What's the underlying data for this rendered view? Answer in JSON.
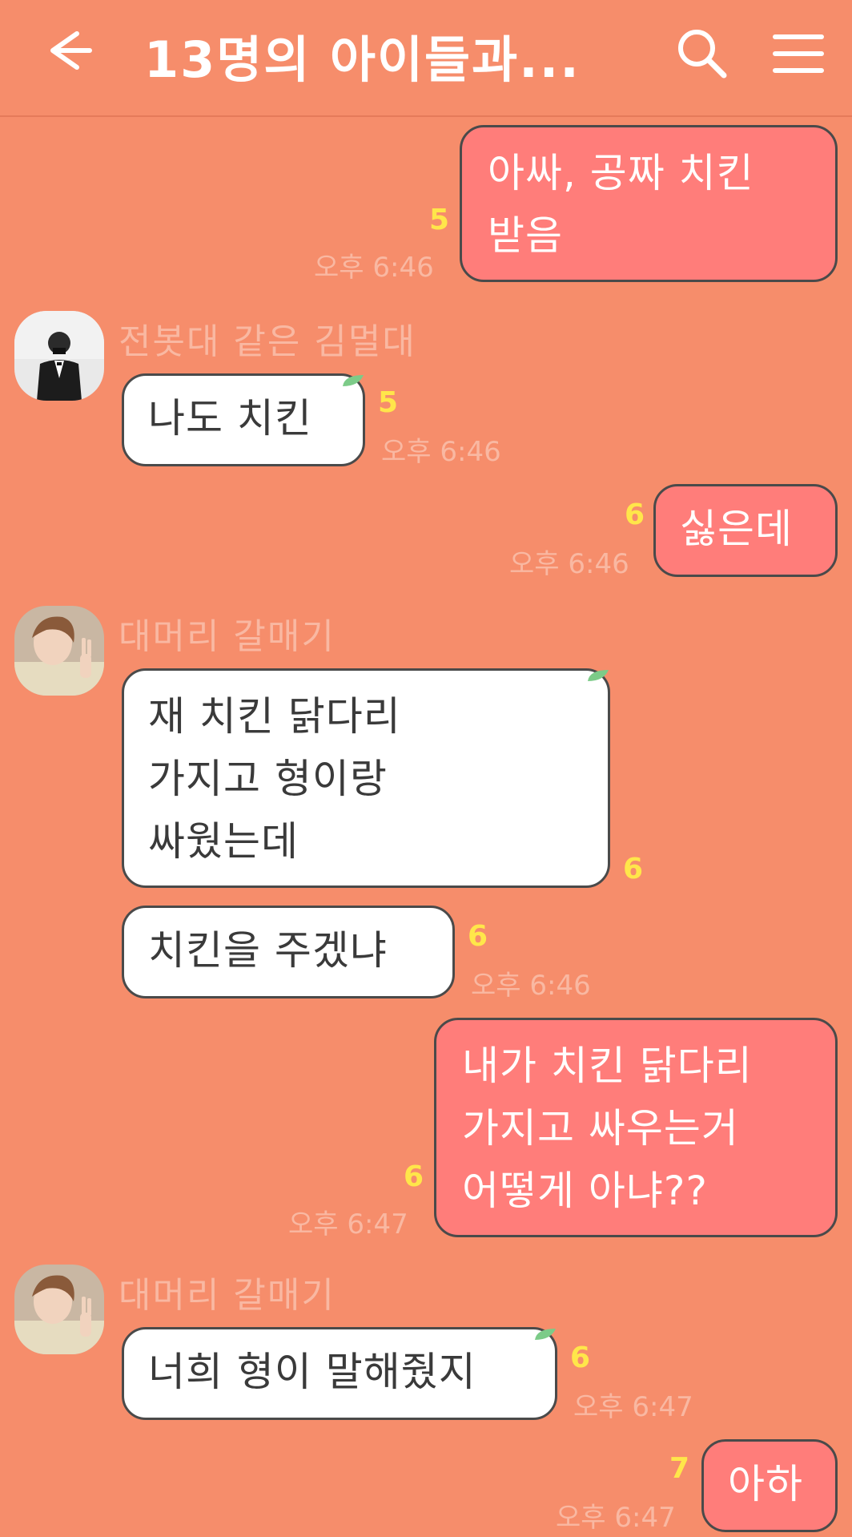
{
  "header": {
    "title": "13명의 아이들과...",
    "back_icon": "arrow-left-icon",
    "search_icon": "search-icon",
    "menu_icon": "hamburger-menu-icon",
    "text_color": "#FFFFFF"
  },
  "colors": {
    "background": "#F68D6B",
    "my_bubble": "#FF7D7A",
    "their_bubble": "#FFFFFF",
    "unread": "#FFE64A",
    "meta": "#F9B8A2"
  },
  "messages": [
    {
      "from": "me",
      "text": "아싸, 공짜 치킨\n받음",
      "unread": "5",
      "time": "오후 6:46"
    },
    {
      "from": "전봇대 같은 김멀대",
      "text": "나도 치킨",
      "unread": "5",
      "time": "오후 6:46"
    },
    {
      "from": "me",
      "text": "싫은데",
      "unread": "6",
      "time": "오후 6:46"
    },
    {
      "from": "대머리 갈매기",
      "text": "재 치킨 닭다리\n가지고 형이랑\n싸웠는데",
      "unread": "6",
      "time": ""
    },
    {
      "from": "대머리 갈매기",
      "text": "치킨을 주겠냐",
      "unread": "6",
      "time": "오후 6:46"
    },
    {
      "from": "me",
      "text": "내가 치킨 닭다리\n가지고 싸우는거\n어떻게 아냐??",
      "unread": "6",
      "time": "오후 6:47"
    },
    {
      "from": "대머리 갈매기",
      "text": "너희 형이 말해줬지",
      "unread": "6",
      "time": "오후 6:47"
    },
    {
      "from": "me",
      "text": "아하",
      "unread": "7",
      "time": "오후 6:47"
    }
  ],
  "senders": {
    "s1": "전봇대 같은 김멀대",
    "s2": "대머리 갈매기",
    "s3": "대머리 갈매기"
  }
}
